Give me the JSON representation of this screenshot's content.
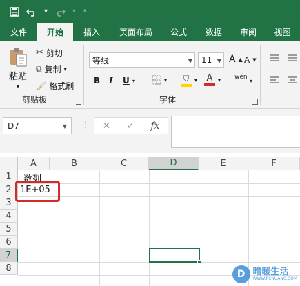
{
  "quick_access": {
    "icons": [
      "save-icon",
      "undo-icon",
      "undo-dropdown-icon",
      "redo-icon",
      "redo-dropdown-icon",
      "customize-qat-icon"
    ]
  },
  "tabs": [
    "文件",
    "开始",
    "插入",
    "页面布局",
    "公式",
    "数据",
    "审阅",
    "视图"
  ],
  "active_tab": "开始",
  "clipboard": {
    "paste_label": "粘贴",
    "cut_label": "剪切",
    "copy_label": "复制",
    "format_painter_label": "格式刷",
    "group_title": "剪贴板"
  },
  "font": {
    "font_name": "等线",
    "font_size": "11",
    "grow_label": "A",
    "shrink_label": "A",
    "bold_label": "B",
    "italic_label": "I",
    "underline_label": "U",
    "font_color_label": "A",
    "phonetic_label": "wén",
    "group_title": "字体"
  },
  "formula_bar": {
    "name_box": "D7",
    "cancel_icon": "✕",
    "enter_icon": "✓",
    "fx_label": "fx",
    "formula": ""
  },
  "sheet": {
    "columns": [
      "A",
      "B",
      "C",
      "D",
      "E",
      "F"
    ],
    "rows": [
      "1",
      "2",
      "3",
      "4",
      "5",
      "6",
      "7",
      "8"
    ],
    "selected_column": "D",
    "selected_row": "7",
    "a1": "数列",
    "a2": "1E+05"
  },
  "watermark": {
    "text": "暗暖生活",
    "sub": "WWW.PCNUANC.COM"
  },
  "colors": {
    "brand": "#217346",
    "highlight": "#d32a2a"
  }
}
